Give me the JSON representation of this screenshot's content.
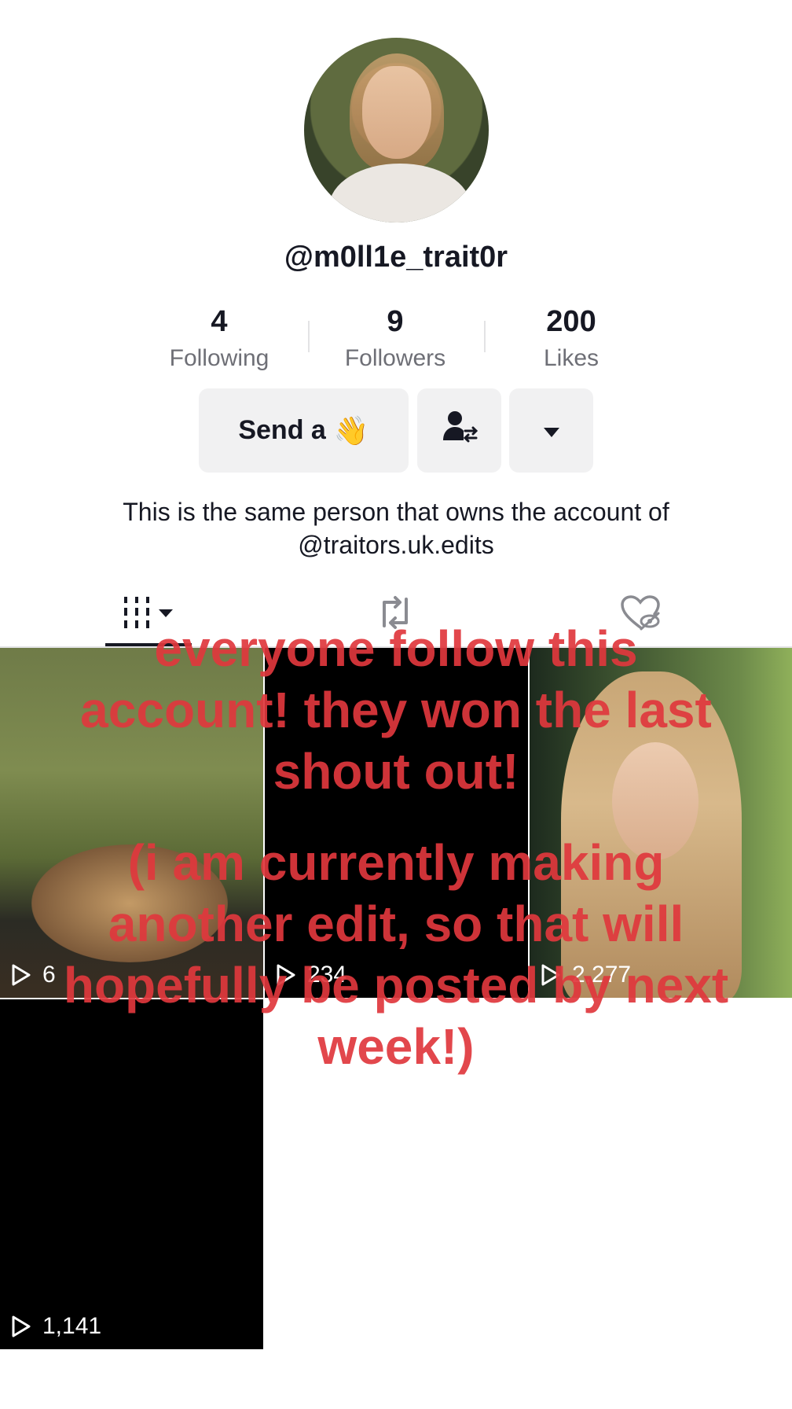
{
  "profile": {
    "username": "@m0ll1e_trait0r",
    "bio_line1": "This is the same person that owns the account of",
    "bio_line2": "@traitors.uk.edits"
  },
  "stats": {
    "following": {
      "value": "4",
      "label": "Following"
    },
    "followers": {
      "value": "9",
      "label": "Followers"
    },
    "likes": {
      "value": "200",
      "label": "Likes"
    }
  },
  "actions": {
    "send_label": "Send a",
    "send_emoji": "👋",
    "friend_icon": "person-swap-icon",
    "more_icon": "caret-down-icon"
  },
  "tabs": [
    {
      "name": "videos",
      "icon": "grid-icon",
      "active": true
    },
    {
      "name": "reposts",
      "icon": "repost-icon"
    },
    {
      "name": "liked",
      "icon": "hidden-heart-icon"
    }
  ],
  "videos": [
    {
      "views": "6"
    },
    {
      "views": "234"
    },
    {
      "views": "2,277"
    },
    {
      "views": "1,141"
    }
  ],
  "overlay": {
    "line1": "everyone follow this",
    "line2": "account! they won the last",
    "line3": "shout out!",
    "line4": "(i am currently making",
    "line5": "another edit, so that will",
    "line6": "hopefully be posted by next",
    "line7": "week!)"
  },
  "colors": {
    "overlay_text": "#e0383d",
    "button_bg": "#f1f1f2",
    "secondary_text": "#6e6f76"
  }
}
